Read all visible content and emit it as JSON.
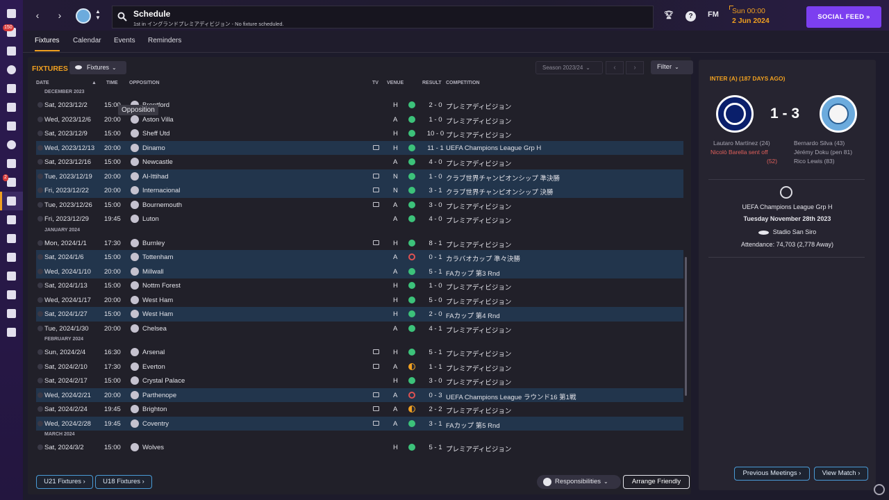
{
  "header": {
    "title": "Schedule",
    "subtitle": "1st in イングランドプレミアディビジョン - No fixture scheduled.",
    "fm_label": "FM",
    "help_label": "?",
    "date_time": "Sun 00:00",
    "date_day": "2 Jun 2024",
    "social_feed": "SOCIAL FEED"
  },
  "sidebar": {
    "badges": [
      "150",
      "2"
    ],
    "items": [
      "home",
      "inbox",
      "squad",
      "dynamics",
      "tactics",
      "data-hub",
      "staff",
      "training",
      "medical",
      "development",
      "schedule",
      "competitions",
      "scouting",
      "transfers",
      "club-info",
      "finances",
      "matchday",
      "analysis"
    ]
  },
  "tabs": [
    "Fixtures",
    "Calendar",
    "Events",
    "Reminders"
  ],
  "toolbar": {
    "heading": "FIXTURES",
    "view_label": "Fixtures",
    "season": "Season 2023/24",
    "filter": "Filter"
  },
  "table": {
    "headers": {
      "date": "DATE",
      "time": "TIME",
      "opposition": "OPPOSITION",
      "tv": "TV",
      "venue": "VENUE",
      "result": "RESULT",
      "competition": "COMPETITION"
    },
    "groups": [
      {
        "month": "DECEMBER 2023",
        "rows": [
          {
            "date": "Sat, 2023/12/2",
            "time": "15:00",
            "team": "Brentford",
            "tv": false,
            "venue": "H",
            "outcome": "win",
            "result": "2 - 0",
            "comp": "プレミアディビジョン",
            "highlight": false
          },
          {
            "date": "Wed, 2023/12/6",
            "time": "20:00",
            "team": "Aston Villa",
            "tv": false,
            "venue": "A",
            "outcome": "win",
            "result": "1 - 0",
            "comp": "プレミアディビジョン",
            "highlight": false
          },
          {
            "date": "Sat, 2023/12/9",
            "time": "15:00",
            "team": "Sheff Utd",
            "tv": false,
            "venue": "H",
            "outcome": "win",
            "result": "10 - 0",
            "comp": "プレミアディビジョン",
            "highlight": false
          },
          {
            "date": "Wed, 2023/12/13",
            "time": "20:00",
            "team": "Dinamo",
            "tv": true,
            "venue": "H",
            "outcome": "win",
            "result": "11 - 1",
            "comp": "UEFA Champions League Grp H",
            "highlight": true
          },
          {
            "date": "Sat, 2023/12/16",
            "time": "15:00",
            "team": "Newcastle",
            "tv": false,
            "venue": "A",
            "outcome": "win",
            "result": "4 - 0",
            "comp": "プレミアディビジョン",
            "highlight": false
          },
          {
            "date": "Tue, 2023/12/19",
            "time": "20:00",
            "team": "Al-Ittihad",
            "tv": true,
            "venue": "N",
            "outcome": "win",
            "result": "1 - 0",
            "comp": "クラブ世界チャンピオンシップ 準決勝",
            "highlight": true
          },
          {
            "date": "Fri, 2023/12/22",
            "time": "20:00",
            "team": "Internacional",
            "tv": true,
            "venue": "N",
            "outcome": "win",
            "result": "3 - 1",
            "comp": "クラブ世界チャンピオンシップ 決勝",
            "highlight": true
          },
          {
            "date": "Tue, 2023/12/26",
            "time": "15:00",
            "team": "Bournemouth",
            "tv": true,
            "venue": "A",
            "outcome": "win",
            "result": "3 - 0",
            "comp": "プレミアディビジョン",
            "highlight": false
          },
          {
            "date": "Fri, 2023/12/29",
            "time": "19:45",
            "team": "Luton",
            "tv": false,
            "venue": "A",
            "outcome": "win",
            "result": "4 - 0",
            "comp": "プレミアディビジョン",
            "highlight": false
          }
        ]
      },
      {
        "month": "JANUARY 2024",
        "rows": [
          {
            "date": "Mon, 2024/1/1",
            "time": "17:30",
            "team": "Burnley",
            "tv": true,
            "venue": "H",
            "outcome": "win",
            "result": "8 - 1",
            "comp": "プレミアディビジョン",
            "highlight": false
          },
          {
            "date": "Sat, 2024/1/6",
            "time": "15:00",
            "team": "Tottenham",
            "tv": false,
            "venue": "A",
            "outcome": "loss",
            "result": "0 - 1",
            "comp": "カラバオカップ 準々決勝",
            "highlight": true
          },
          {
            "date": "Wed, 2024/1/10",
            "time": "20:00",
            "team": "Millwall",
            "tv": false,
            "venue": "A",
            "outcome": "win",
            "result": "5 - 1",
            "comp": "FAカップ 第3 Rnd",
            "highlight": true
          },
          {
            "date": "Sat, 2024/1/13",
            "time": "15:00",
            "team": "Nottm Forest",
            "tv": false,
            "venue": "H",
            "outcome": "win",
            "result": "1 - 0",
            "comp": "プレミアディビジョン",
            "highlight": false
          },
          {
            "date": "Wed, 2024/1/17",
            "time": "20:00",
            "team": "West Ham",
            "tv": false,
            "venue": "H",
            "outcome": "win",
            "result": "5 - 0",
            "comp": "プレミアディビジョン",
            "highlight": false
          },
          {
            "date": "Sat, 2024/1/27",
            "time": "15:00",
            "team": "West Ham",
            "tv": false,
            "venue": "H",
            "outcome": "win",
            "result": "2 - 0",
            "comp": "FAカップ 第4 Rnd",
            "highlight": true
          },
          {
            "date": "Tue, 2024/1/30",
            "time": "20:00",
            "team": "Chelsea",
            "tv": false,
            "venue": "A",
            "outcome": "win",
            "result": "4 - 1",
            "comp": "プレミアディビジョン",
            "highlight": false
          }
        ]
      },
      {
        "month": "FEBRUARY 2024",
        "rows": [
          {
            "date": "Sun, 2024/2/4",
            "time": "16:30",
            "team": "Arsenal",
            "tv": true,
            "venue": "H",
            "outcome": "win",
            "result": "5 - 1",
            "comp": "プレミアディビジョン",
            "highlight": false
          },
          {
            "date": "Sat, 2024/2/10",
            "time": "17:30",
            "team": "Everton",
            "tv": true,
            "venue": "A",
            "outcome": "draw",
            "result": "1 - 1",
            "comp": "プレミアディビジョン",
            "highlight": false
          },
          {
            "date": "Sat, 2024/2/17",
            "time": "15:00",
            "team": "Crystal Palace",
            "tv": false,
            "venue": "H",
            "outcome": "win",
            "result": "3 - 0",
            "comp": "プレミアディビジョン",
            "highlight": false
          },
          {
            "date": "Wed, 2024/2/21",
            "time": "20:00",
            "team": "Parthenope",
            "tv": true,
            "venue": "A",
            "outcome": "loss",
            "result": "0 - 3",
            "comp": "UEFA Champions League ラウンド16 第1戦",
            "highlight": true
          },
          {
            "date": "Sat, 2024/2/24",
            "time": "19:45",
            "team": "Brighton",
            "tv": true,
            "venue": "A",
            "outcome": "draw",
            "result": "2 - 2",
            "comp": "プレミアディビジョン",
            "highlight": false
          },
          {
            "date": "Wed, 2024/2/28",
            "time": "19:45",
            "team": "Coventry",
            "tv": true,
            "venue": "A",
            "outcome": "win",
            "result": "3 - 1",
            "comp": "FAカップ 第5 Rnd",
            "highlight": true
          }
        ]
      },
      {
        "month": "MARCH 2024",
        "rows": [
          {
            "date": "Sat, 2024/3/2",
            "time": "15:00",
            "team": "Wolves",
            "tv": false,
            "venue": "H",
            "outcome": "win",
            "result": "5 - 1",
            "comp": "プレミアディビジョン",
            "highlight": false
          }
        ]
      }
    ]
  },
  "tooltip": "Opposition",
  "bottom": {
    "u21": "U21 Fixtures ›",
    "u18": "U18 Fixtures ›",
    "responsibilities": "Responsibilities",
    "arrange": "Arrange Friendly"
  },
  "match_panel": {
    "title": "INTER (A) (187 DAYS AGO)",
    "score": "1 - 3",
    "home_scorers": [
      "Lautaro Martínez (24)"
    ],
    "home_red": [
      "Nicolò Barella sent off",
      "(52)"
    ],
    "away_scorers": [
      "Bernardo Silva (43)",
      "Jérémy Doku (pen 81)",
      "Rico Lewis (83)"
    ],
    "competition": "UEFA Champions League Grp H",
    "date": "Tuesday November 28th 2023",
    "stadium": "Stadio San Siro",
    "attendance": "Attendance: 74,703 (2,778 Away)",
    "prev_meetings": "Previous Meetings ›",
    "view_match": "View Match ›"
  },
  "colors": {
    "accent": "#f0a020",
    "win": "#3cc27a",
    "loss": "#e05252",
    "draw": "#f0a020",
    "highlight_row": "#22354c",
    "social_feed": "#7c3ff0"
  }
}
